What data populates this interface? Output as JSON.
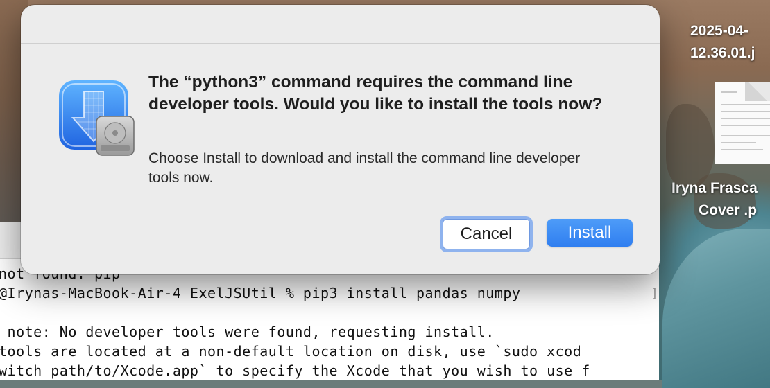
{
  "dialog": {
    "title": "The “python3” command requires the command line developer tools. Would you like to install the tools now?",
    "message": "Choose Install to download and install the command line developer tools now.",
    "cancel_label": "Cancel",
    "install_label": "Install",
    "accent_color": "#2f7ef0",
    "icon": "xcode-install-tools-icon"
  },
  "desktop": {
    "file1_line1": "2025-04-",
    "file1_line2": "12.36.01.j",
    "file2_line1": "Iryna Frasca",
    "file2_line2": "Cover .p",
    "file2_icon": "document-icon"
  },
  "terminal": {
    "lines": [
      "not found: pip",
      "@Irynas-MacBook-Air-4 ExelJSUtil % pip3 install pandas numpy",
      "",
      " note: No developer tools were found, requesting install.",
      "tools are located at a non-default location on disk, use `sudo xcod",
      "witch path/to/Xcode.app` to specify the Xcode that you wish to use f"
    ]
  }
}
